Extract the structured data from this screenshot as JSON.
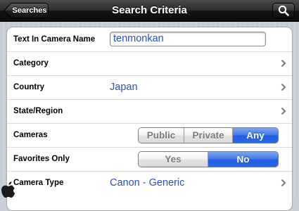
{
  "navbar": {
    "back_label": "Searches",
    "title": "Search Criteria"
  },
  "rows": {
    "text_in_camera_name": {
      "label": "Text In Camera Name",
      "value": "tenmonkan"
    },
    "category": {
      "label": "Category"
    },
    "country": {
      "label": "Country",
      "value": "Japan"
    },
    "state_region": {
      "label": "State/Region"
    },
    "cameras": {
      "label": "Cameras",
      "options": [
        "Public",
        "Private",
        "Any"
      ],
      "selected": "Any"
    },
    "favorites_only": {
      "label": "Favorites Only",
      "options": [
        "Yes",
        "No"
      ],
      "selected": "No"
    },
    "camera_type": {
      "label": "Camera Type",
      "value": "Canon - Generic"
    }
  },
  "icons": {
    "search": "magnifier-icon",
    "disclosure": "chevron-right-icon"
  },
  "colors": {
    "value_text": "#2a4fc4",
    "segment_selected": "#2a66e4"
  }
}
